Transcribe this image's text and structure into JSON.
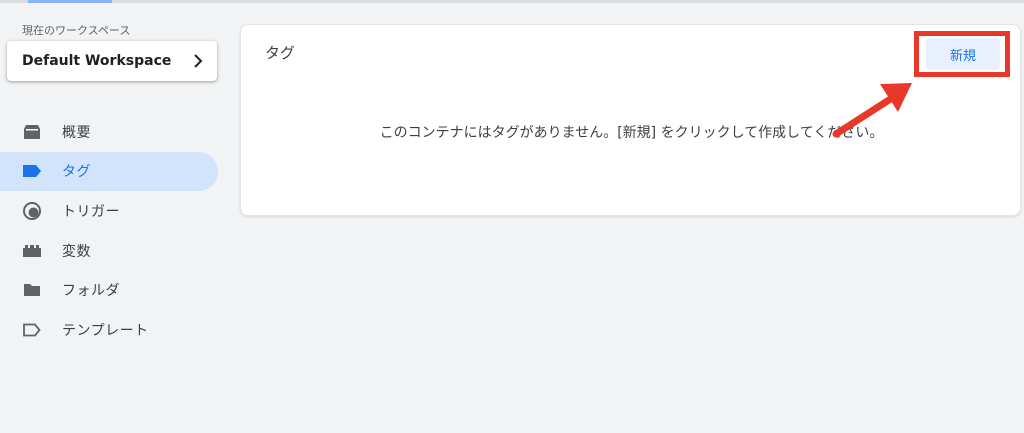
{
  "workspace": {
    "label": "現在のワークスペース",
    "name": "Default Workspace"
  },
  "sidebar": {
    "items": [
      {
        "label": "概要",
        "icon": "overview-icon",
        "active": false
      },
      {
        "label": "タグ",
        "icon": "tag-icon",
        "active": true
      },
      {
        "label": "トリガー",
        "icon": "trigger-icon",
        "active": false
      },
      {
        "label": "変数",
        "icon": "variable-icon",
        "active": false
      },
      {
        "label": "フォルダ",
        "icon": "folder-icon",
        "active": false
      },
      {
        "label": "テンプレート",
        "icon": "template-icon",
        "active": false
      }
    ]
  },
  "main": {
    "card_title": "タグ",
    "new_button_label": "新規",
    "empty_message": "このコンテナにはタグがありません。[新規] をクリックして作成してください。"
  },
  "colors": {
    "accent": "#1a73e8",
    "active_bg": "#d2e3fc",
    "annotation": "#e8382a"
  }
}
